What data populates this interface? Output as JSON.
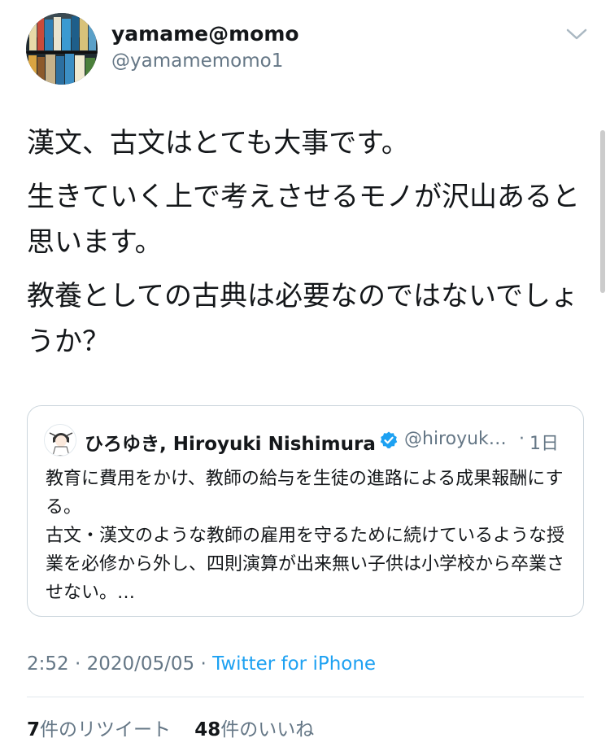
{
  "author": {
    "display_name": "yamame@momo",
    "handle": "@yamamemomo1",
    "avatar_icon": "bookshelf-avatar"
  },
  "menu_icon": "chevron-down-icon",
  "tweet": {
    "paragraphs": [
      "漢文、古文はとても大事です。",
      "生きていく上で考えさせるモノが沢山あると思います。",
      "教養としての古典は必要なのではないでしょうか？"
    ]
  },
  "quoted_tweet": {
    "display_name": "ひろゆき, Hiroyuki Nishimura",
    "verified_icon": "verified-badge-icon",
    "handle": "@hiroyuk…",
    "separator": "·",
    "time": "1日",
    "text_lines": [
      "教育に費用をかけ、教師の給与を生徒の進路による成果報酬にする。",
      "古文・漢文のような教師の雇用を守るために続けているような授業を必修から外し、四則演算が出来無い子供は小学校から卒業させない。…"
    ]
  },
  "meta": {
    "time": "2:52",
    "separator": "·",
    "date": "2020/05/05",
    "source": "Twitter for iPhone"
  },
  "stats": {
    "retweets_count": "7",
    "retweets_label": "件のリツイート",
    "likes_count": "48",
    "likes_label": "件のいいね"
  },
  "colors": {
    "link": "#1da1f2",
    "secondary_text": "#657786",
    "border": "#ccd6dd"
  }
}
